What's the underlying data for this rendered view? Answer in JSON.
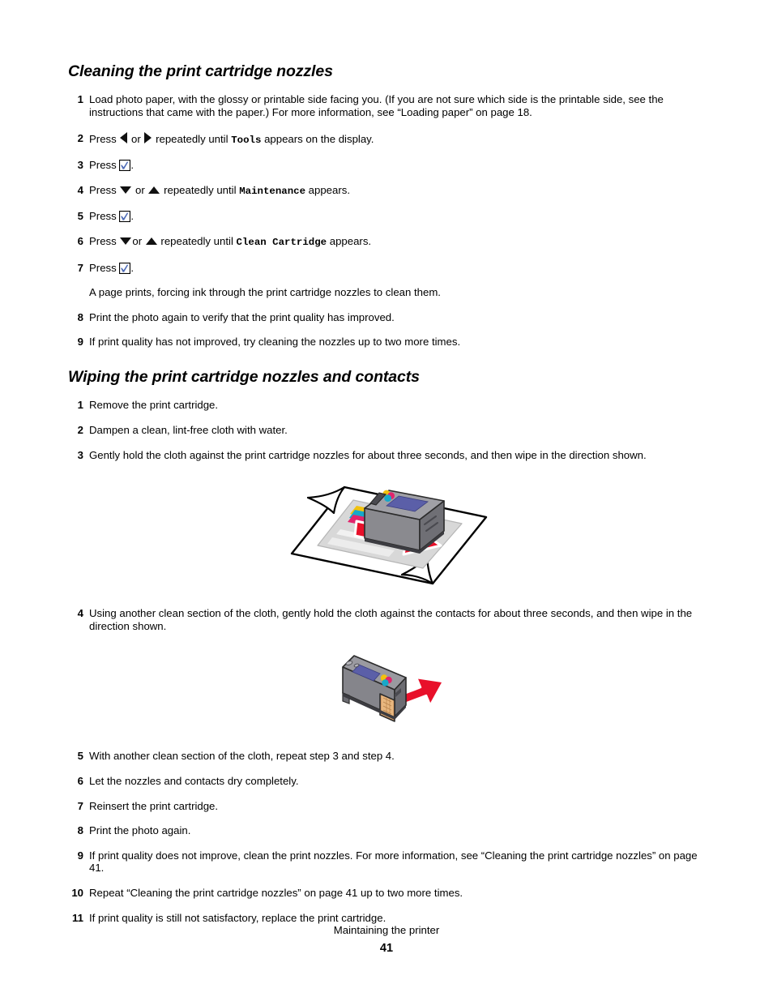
{
  "document": {
    "footer_title": "Maintaining the printer",
    "page_number": "41"
  },
  "sections": [
    {
      "heading": "Cleaning the print cartridge nozzles",
      "steps": [
        {
          "number": "1",
          "text": "Load photo paper, with the glossy or printable side facing you. (If you are not sure which side is the printable side, see the instructions that came with the paper.) For more information, see “Loading paper” on page 18."
        },
        {
          "number": "2",
          "pre": "Press ",
          "icon_a": "left-arrow-icon",
          "mid": " or ",
          "icon_b": "right-arrow-icon",
          "post": " repeatedly until ",
          "mono": "Tools",
          "tail": " appears on the display."
        },
        {
          "number": "3",
          "pre": "Press ",
          "icon_a": "select-check-icon",
          "tail": "."
        },
        {
          "number": "4",
          "pre": "Press ",
          "icon_a": "down-arrow-icon",
          "mid": " or ",
          "icon_b": "up-arrow-icon",
          "post": " repeatedly until ",
          "mono": "Maintenance",
          "tail": " appears."
        },
        {
          "number": "5",
          "pre": "Press ",
          "icon_a": "select-check-icon",
          "tail": "."
        },
        {
          "number": "6",
          "pre": "Press ",
          "icon_a": "down-arrow-icon",
          "mid": "or ",
          "icon_b": "up-arrow-icon",
          "post": " repeatedly until ",
          "mono": "Clean Cartridge",
          "tail": "  appears."
        },
        {
          "number": "7",
          "pre": "Press ",
          "icon_a": "select-check-icon",
          "tail": "."
        },
        {
          "number": "",
          "text": "A page prints, forcing ink through the print cartridge nozzles to clean them."
        },
        {
          "number": "8",
          "text": "Print the photo again to verify that the print quality has improved."
        },
        {
          "number": "9",
          "text": "If print quality has not improved, try cleaning the nozzles up to two more times."
        }
      ]
    },
    {
      "heading": "Wiping the print cartridge nozzles and contacts",
      "steps": [
        {
          "number": "1",
          "text": "Remove the print cartridge."
        },
        {
          "number": "2",
          "text": "Dampen a clean, lint-free cloth with water."
        },
        {
          "number": "3",
          "text": "Gently hold the cloth against the print cartridge nozzles for about three seconds, and then wipe in the direction shown."
        },
        {
          "number": "4",
          "text": "Using another clean section of the cloth, gently hold the cloth against the contacts for about three seconds, and then wipe in the direction shown."
        },
        {
          "number": "5",
          "text": "With another clean section of the cloth, repeat step 3 and step 4."
        },
        {
          "number": "6",
          "text": "Let the nozzles and contacts dry completely."
        },
        {
          "number": "7",
          "text": "Reinsert the print cartridge."
        },
        {
          "number": "8",
          "text": "Print the photo again."
        },
        {
          "number": "9",
          "text": "If print quality does not improve, clean the print nozzles. For more information, see “Cleaning the print cartridge nozzles” on page 41."
        },
        {
          "number": "10",
          "text": "Repeat “Cleaning the print cartridge nozzles” on page 41 up to two more times."
        },
        {
          "number": "11",
          "text": "If print quality is still not satisfactory, replace the print cartridge."
        }
      ]
    }
  ],
  "figures": {
    "nozzle_wipe": {
      "name": "cartridge-on-cloth-illustration",
      "description": "Print cartridge resting on a lint-free cloth with a red arrow showing the wipe direction"
    },
    "contact_wipe": {
      "name": "cartridge-contacts-illustration",
      "description": "Print cartridge showing copper contacts with a red arrow showing the wipe direction"
    }
  },
  "colors": {
    "arrow_red": "#e8102a",
    "cartridge_body": "#8a8a8f",
    "cartridge_top": "#6e6e74",
    "label_blue": "#5b5fa8",
    "contacts_copper": "#d9a06a",
    "cloth_gray": "#d8d8d8",
    "check_blue": "#4b69b5"
  }
}
